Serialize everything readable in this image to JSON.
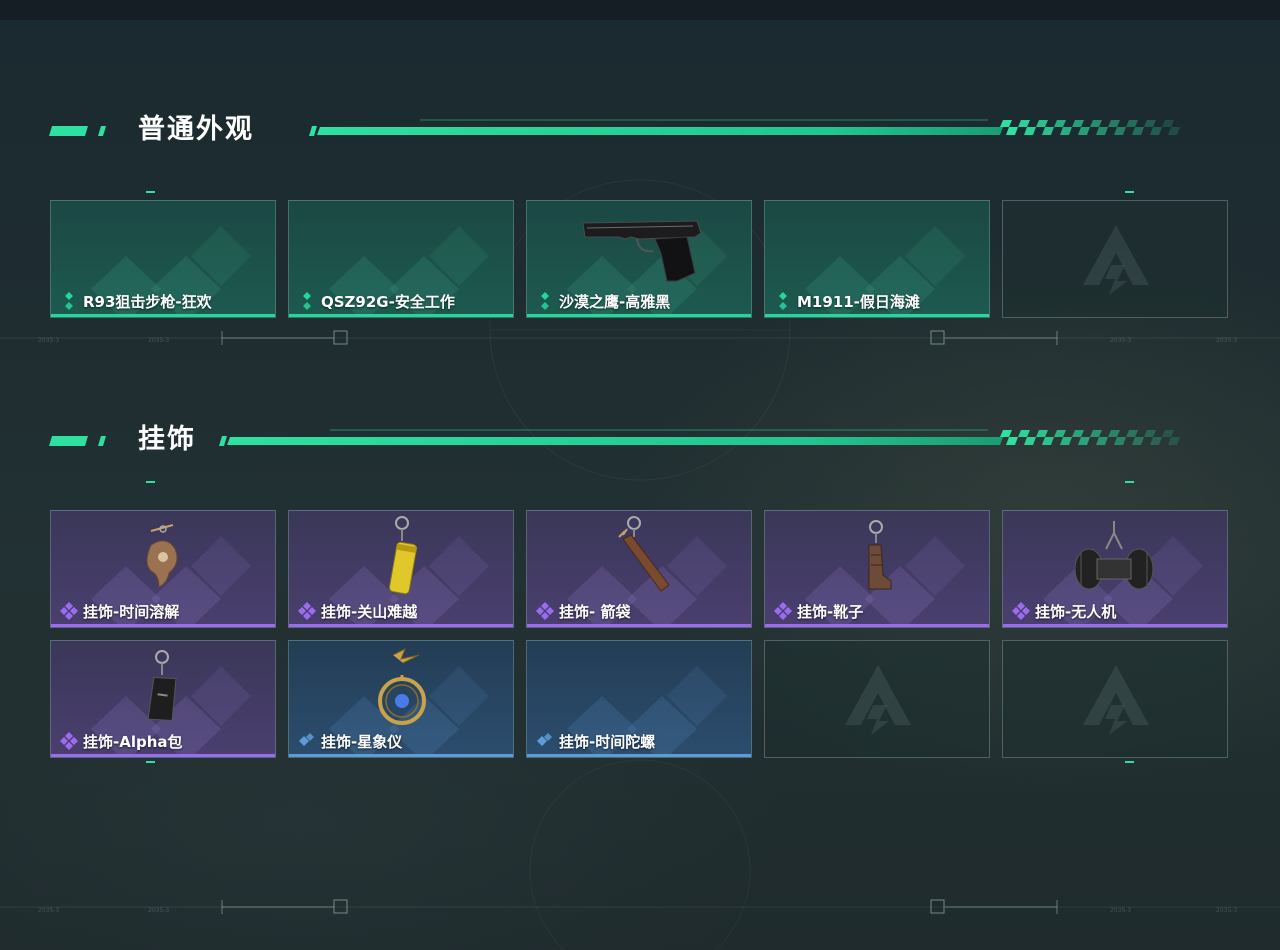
{
  "sections": [
    {
      "title": "普通外观",
      "items": [
        {
          "label": "R93狙击步枪-狂欢",
          "rarity": "green",
          "icon": "diamond-green-icon",
          "image": null
        },
        {
          "label": "QSZ92G-安全工作",
          "rarity": "green",
          "icon": "diamond-green-icon",
          "image": null
        },
        {
          "label": "沙漠之鹰-高雅黑",
          "rarity": "green",
          "icon": "diamond-green-icon",
          "image": "pistol-image"
        },
        {
          "label": "M1911-假日海滩",
          "rarity": "green",
          "icon": "diamond-green-icon",
          "image": null
        },
        {
          "label": null,
          "rarity": "empty",
          "icon": "empty-slot-logo-icon",
          "image": null
        }
      ]
    },
    {
      "title": "挂饰",
      "items": [
        {
          "label": "挂饰-时间溶解",
          "rarity": "purple",
          "icon": "diamond-purple-icon",
          "image": "melting-clock-charm-image"
        },
        {
          "label": "挂饰-关山难越",
          "rarity": "purple",
          "icon": "diamond-purple-icon",
          "image": "yellow-canister-charm-image"
        },
        {
          "label": "挂饰- 箭袋",
          "rarity": "purple",
          "icon": "diamond-purple-icon",
          "image": "quiver-charm-image"
        },
        {
          "label": "挂饰-靴子",
          "rarity": "purple",
          "icon": "diamond-purple-icon",
          "image": "boot-charm-image"
        },
        {
          "label": "挂饰-无人机",
          "rarity": "purple",
          "icon": "diamond-purple-icon",
          "image": "drone-charm-image"
        },
        {
          "label": "挂饰-Alpha包",
          "rarity": "purple",
          "icon": "diamond-purple-icon",
          "image": "alpha-bag-charm-image"
        },
        {
          "label": "挂饰-星象仪",
          "rarity": "blue",
          "icon": "diamond-blue-icon",
          "image": "astrolabe-charm-image"
        },
        {
          "label": "挂饰-时间陀螺",
          "rarity": "blue",
          "icon": "diamond-blue-icon",
          "image": null
        },
        {
          "label": null,
          "rarity": "empty",
          "icon": "empty-slot-logo-icon",
          "image": null
        },
        {
          "label": null,
          "rarity": "empty",
          "icon": "empty-slot-logo-icon",
          "image": null
        }
      ]
    }
  ],
  "colors": {
    "green": "#27d69a",
    "purple": "#9c6cf0",
    "blue": "#5d9cd8",
    "accent": "#2fe0a0"
  }
}
